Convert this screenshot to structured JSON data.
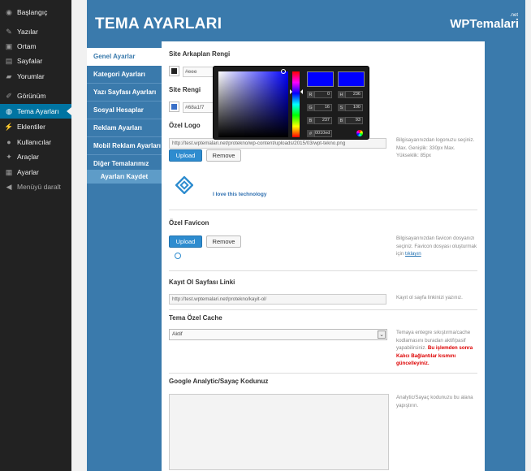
{
  "sidebar": {
    "items": [
      {
        "label": "Başlangıç",
        "icon": "dashboard-icon"
      },
      {
        "label": "Yazılar",
        "icon": "pin-icon"
      },
      {
        "label": "Ortam",
        "icon": "media-icon"
      },
      {
        "label": "Sayfalar",
        "icon": "page-icon"
      },
      {
        "label": "Yorumlar",
        "icon": "comment-icon"
      },
      {
        "label": "Görünüm",
        "icon": "brush-icon"
      },
      {
        "label": "Tema Ayarları",
        "icon": "globe-icon"
      },
      {
        "label": "Eklentiler",
        "icon": "plugin-icon"
      },
      {
        "label": "Kullanıcılar",
        "icon": "user-icon"
      },
      {
        "label": "Araçlar",
        "icon": "wrench-icon"
      },
      {
        "label": "Ayarlar",
        "icon": "settings-icon"
      },
      {
        "label": "Menüyü daralt",
        "icon": "collapse-icon"
      }
    ]
  },
  "header": {
    "title": "TEMA AYARLARI",
    "brand": "WPTemalari",
    "brand_suffix": ".net"
  },
  "tabs": [
    {
      "label": "Genel Ayarlar"
    },
    {
      "label": "Kategori Ayarları"
    },
    {
      "label": "Yazı Sayfası Ayarları"
    },
    {
      "label": "Sosyal Hesaplar"
    },
    {
      "label": "Reklam Ayarları"
    },
    {
      "label": "Mobil Reklam Ayarları"
    },
    {
      "label": "Diğer Temalarımız"
    }
  ],
  "save_label": "Ayarları Kaydet",
  "settings": {
    "bg_color": {
      "title": "Site Arkaplan Rengi",
      "value": "#eee",
      "swatch": "#eeeeee"
    },
    "site_color": {
      "title": "Site Rengi",
      "value": "#68a1f7",
      "swatch": "#68a1f7"
    },
    "logo": {
      "title": "Özel Logo",
      "url": "http://test.wptemalari.net/protekno/wp-content/uploads/2015/03/wpt-tekno.png",
      "upload": "Upload",
      "remove": "Remove",
      "hint": "Bilgisayarınızdan logonuzu seçiniz. Max. Genişlik: 330px Max. Yükseklik: 85px",
      "preview_text": "I love this technology"
    },
    "favicon": {
      "title": "Özel Favicon",
      "upload": "Upload",
      "remove": "Remove",
      "hint": "Bilgisayarınızdan favicon dosyanızı seçiniz. Favicon dosyası oluşturmak için",
      "hint_link": "tıklayın"
    },
    "register": {
      "title": "Kayıt Ol Sayfası Linki",
      "url": "http://test.wptemalari.net/protekno/kayit-ol/",
      "hint": "Kayıt ol sayfa linkinizi yazınız."
    },
    "cache": {
      "title": "Tema Özel Cache",
      "selected": "Aktif",
      "hint": "Temaya entegre sıkıştırma/cache kodlamasını buradan aktif/pasif yapabilirsiniz.",
      "warning": "Bu işlemden sonra Kalıcı Bağlantılar kısmını güncelleyiniz."
    },
    "analytics": {
      "title": "Google Analytic/Sayaç Kodunuz",
      "value": "",
      "hint": "Analytic/Sayaç kodunuzu bu alana yapıştırın."
    }
  },
  "picker": {
    "current_color": "#0000ff",
    "fields": [
      {
        "label": "R",
        "value": "0"
      },
      {
        "label": "G",
        "value": "16"
      },
      {
        "label": "B",
        "value": "237"
      },
      {
        "label": "H",
        "value": "236"
      },
      {
        "label": "S",
        "value": "100"
      },
      {
        "label": "B",
        "value": "93"
      }
    ],
    "hex_label": "#",
    "hex": "0010ed"
  }
}
